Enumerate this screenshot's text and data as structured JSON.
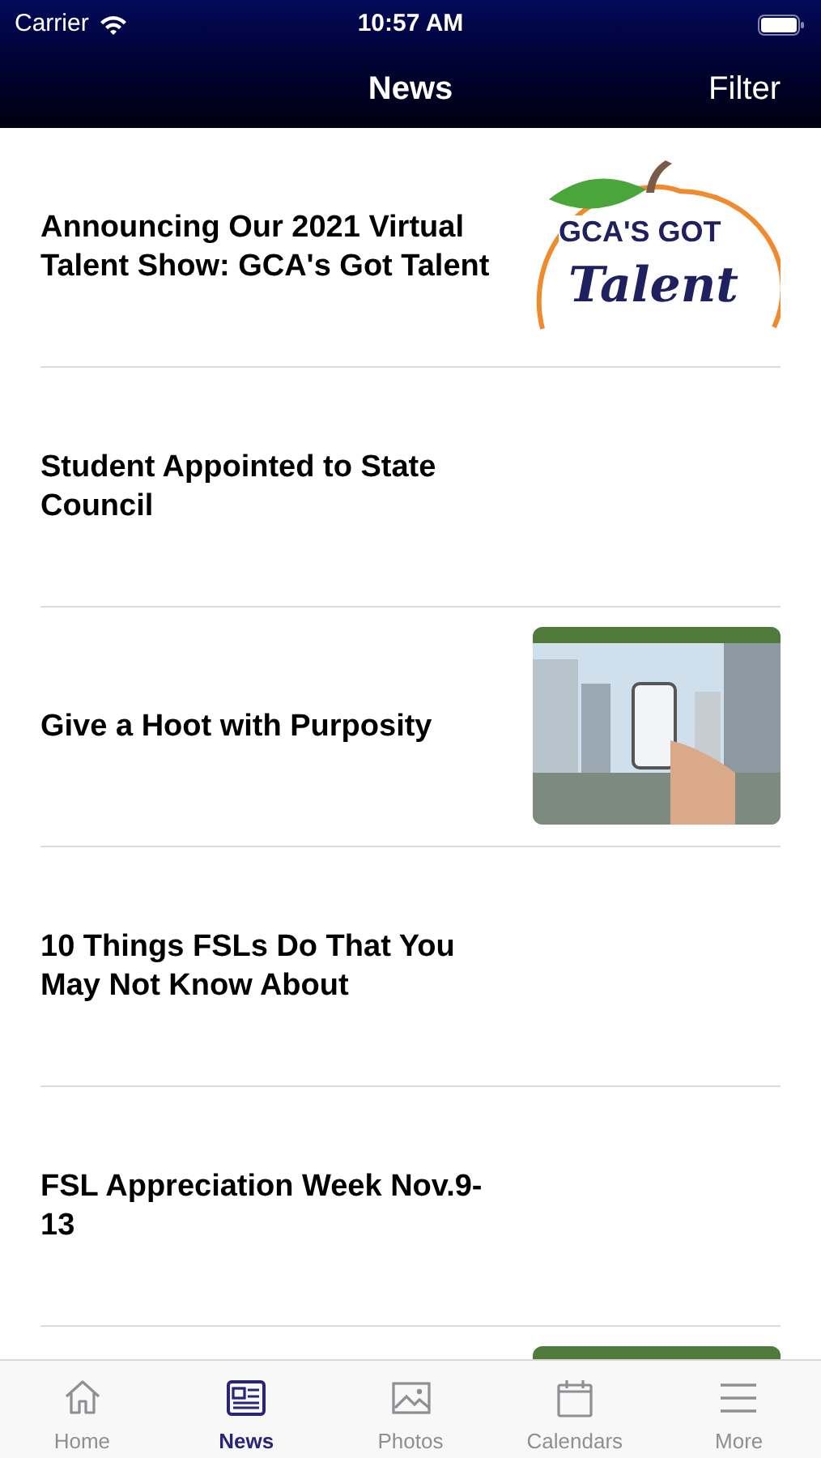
{
  "status_bar": {
    "carrier": "Carrier",
    "time": "10:57 AM"
  },
  "nav": {
    "title": "News",
    "action": "Filter"
  },
  "articles": [
    {
      "title": "Announcing Our 2021 Virtual Talent Show: GCA's Got Talent",
      "thumbnail": {
        "kind": "logo",
        "lines": [
          "GCA'S GOT",
          "Talent"
        ]
      }
    },
    {
      "title": "Student Appointed to State Council"
    },
    {
      "title": "Give a Hoot with Purposity",
      "thumbnail": {
        "kind": "picture"
      }
    },
    {
      "title": "10 Things FSLs Do That You May Not Know About"
    },
    {
      "title": "FSL Appreciation Week Nov.9-13"
    },
    {
      "thumbnail": {
        "kind": "picture"
      }
    }
  ],
  "tabs": [
    {
      "label": "Home",
      "kind": "home",
      "selected": false
    },
    {
      "label": "News",
      "kind": "news",
      "selected": true
    },
    {
      "label": "Photos",
      "kind": "photos",
      "selected": false
    },
    {
      "label": "Calendars",
      "kind": "calendar",
      "selected": false
    },
    {
      "label": "More",
      "kind": "more",
      "selected": false
    }
  ]
}
